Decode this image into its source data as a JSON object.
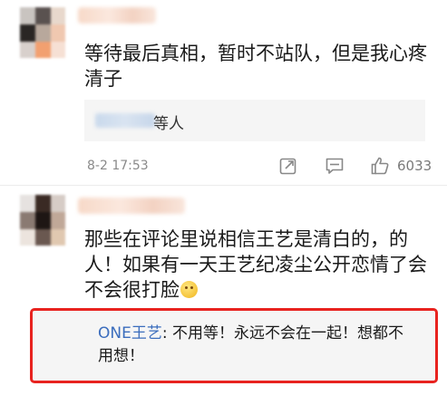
{
  "comments": [
    {
      "text": "等待最后真相，暂时不站队，但是我心疼清子",
      "reply_summary_suffix": "等人",
      "timestamp": "8-2 17:53",
      "like_count": "6033",
      "icons": [
        "share-icon",
        "comment-icon",
        "thumbs-up-icon"
      ]
    },
    {
      "text": "那些在评论里说相信王艺是清白的，的人！如果有一天王艺纪凌尘公开恋情了会不会很打脸",
      "reply": {
        "author": "ONE王艺",
        "separator": ": ",
        "text": "不用等！永远不会在一起！想都不用想！"
      }
    }
  ],
  "colors": {
    "highlight_border": "#e8231f",
    "reply_author": "#3b6dbd",
    "reply_bg": "#f5f5f5"
  }
}
